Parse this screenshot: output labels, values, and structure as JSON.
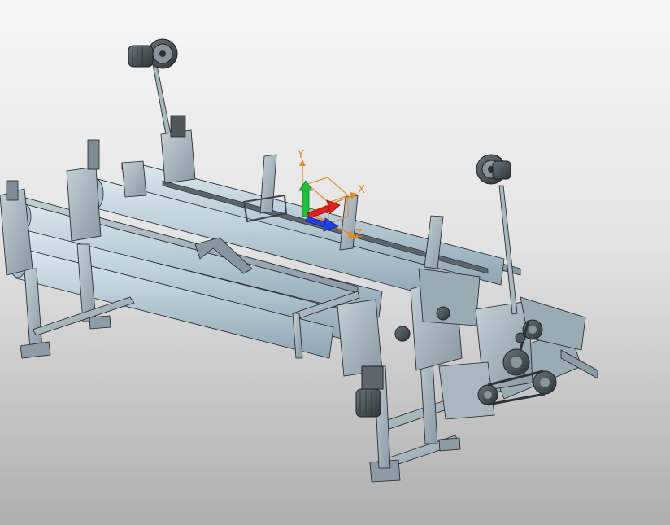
{
  "viewport": {
    "axis_labels": {
      "y": "Y",
      "x": "X",
      "z": "Z"
    }
  },
  "colors": {
    "background_top": "#f7f7f7",
    "background_bottom": "#aeaeae",
    "roller": "#b9ccd6",
    "steel": "#9fb0ba",
    "dark_part": "#3e474d",
    "outline": "#1d2226",
    "axis_x": "#e02020",
    "axis_y": "#22c040",
    "axis_z": "#2040e0",
    "axis_label": "#e0882a"
  },
  "icons": [
    "view-triad-icon",
    "motor-icon"
  ]
}
